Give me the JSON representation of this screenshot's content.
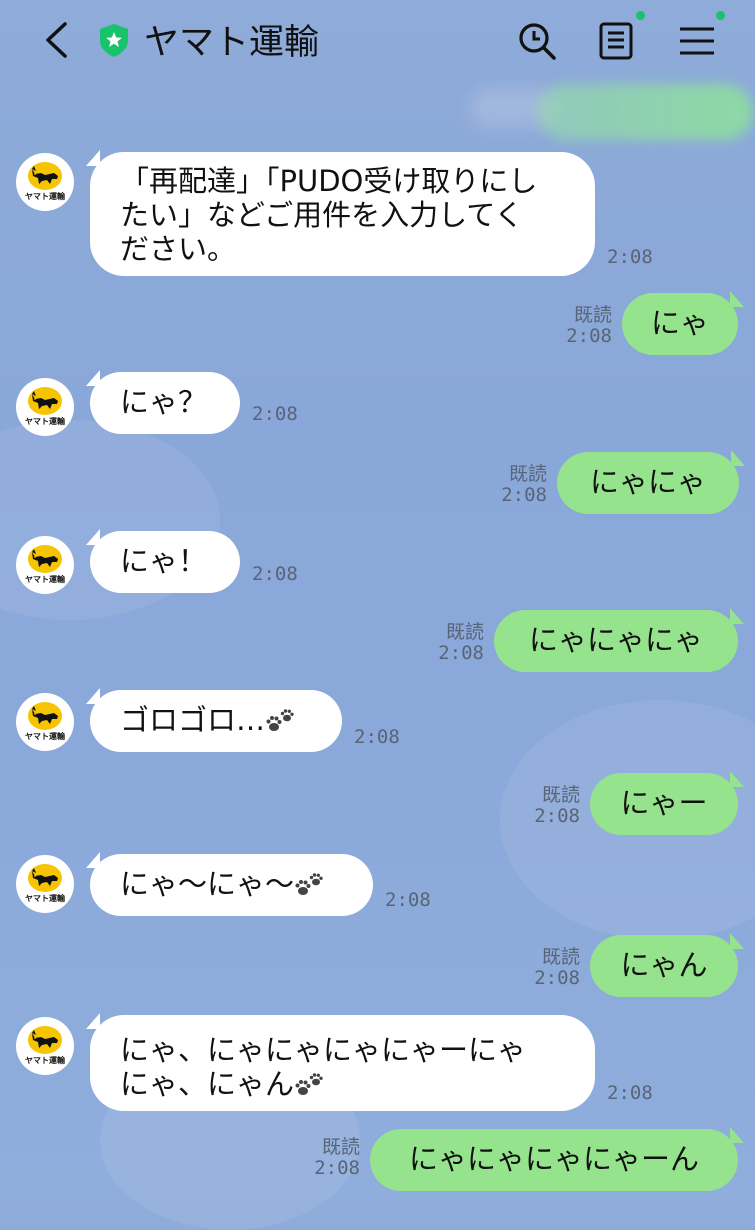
{
  "header": {
    "title": "ヤマト運輸",
    "back_icon": "chevron-left-icon",
    "verified_icon": "shield-star-icon",
    "search_icon": "search-icon",
    "notes_icon": "note-icon",
    "menu_icon": "menu-icon",
    "accent": "#19c36a"
  },
  "avatar_caption": "ヤマト運輸",
  "colors": {
    "incoming_bubble": "#ffffff",
    "outgoing_bubble": "#95e38c",
    "background": "#8ba9da"
  },
  "messages": [
    {
      "dir": "in",
      "lines": [
        "「再配達」「PUDO受け取りにし",
        "たい」などご用件を入力してく",
        "ださい。"
      ],
      "time": "2:08"
    },
    {
      "dir": "out",
      "text": "にゃ",
      "read": "既読",
      "time": "2:08"
    },
    {
      "dir": "in",
      "text": "にゃ？",
      "time": "2:08"
    },
    {
      "dir": "out",
      "text": "にゃにゃ",
      "read": "既読",
      "time": "2:08"
    },
    {
      "dir": "in",
      "text": "にゃ！",
      "time": "2:08"
    },
    {
      "dir": "out",
      "text": "にゃにゃにゃ",
      "read": "既読",
      "time": "2:08"
    },
    {
      "dir": "in",
      "text": "ゴロゴロ…",
      "paw": true,
      "time": "2:08"
    },
    {
      "dir": "out",
      "text": "にゃー",
      "read": "既読",
      "time": "2:08"
    },
    {
      "dir": "in",
      "text": "にゃ〜にゃ〜",
      "paw": true,
      "time": "2:08"
    },
    {
      "dir": "out",
      "text": "にゃん",
      "read": "既読",
      "time": "2:08"
    },
    {
      "dir": "in",
      "lines": [
        "にゃ、にゃにゃにゃにゃーにゃ",
        "にゃ、にゃん"
      ],
      "paw": true,
      "time": "2:08"
    },
    {
      "dir": "out",
      "text": "にゃにゃにゃにゃーん",
      "read": "既読",
      "time": "2:08"
    }
  ]
}
